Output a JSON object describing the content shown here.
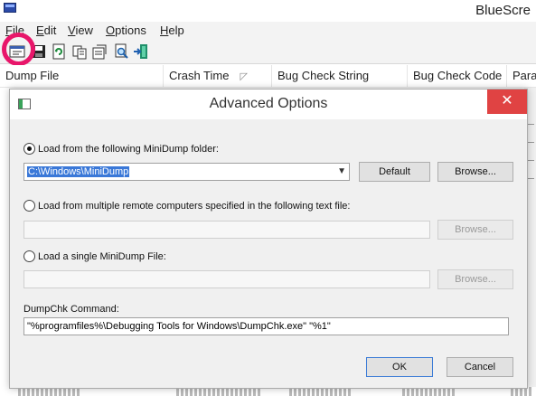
{
  "app": {
    "title": "BlueScre",
    "menu": [
      "File",
      "Edit",
      "View",
      "Options",
      "Help"
    ],
    "columns": [
      "Dump File",
      "Crash Time",
      "Bug Check String",
      "Bug Check Code",
      "Para"
    ],
    "toolbar_icons": [
      "advanced-options-icon",
      "save-icon",
      "refresh-icon",
      "copy-icon",
      "properties-icon",
      "find-icon",
      "exit-icon"
    ]
  },
  "dialog": {
    "title": "Advanced Options",
    "close_glyph": "✕",
    "option_minidump_folder": "Load from the following MiniDump folder:",
    "minidump_folder_value": "C:\\Windows\\MiniDump",
    "default_label": "Default",
    "browse_label": "Browse...",
    "option_remote_computers": "Load from multiple remote computers specified in the following text file:",
    "remote_file_value": "",
    "option_single_file": "Load a single MiniDump File:",
    "single_file_value": "",
    "dumpchk_label": "DumpChk Command:",
    "dumpchk_value": "\"%programfiles%\\Debugging Tools for Windows\\DumpChk.exe\" \"%1\"",
    "ok_label": "OK",
    "cancel_label": "Cancel"
  }
}
